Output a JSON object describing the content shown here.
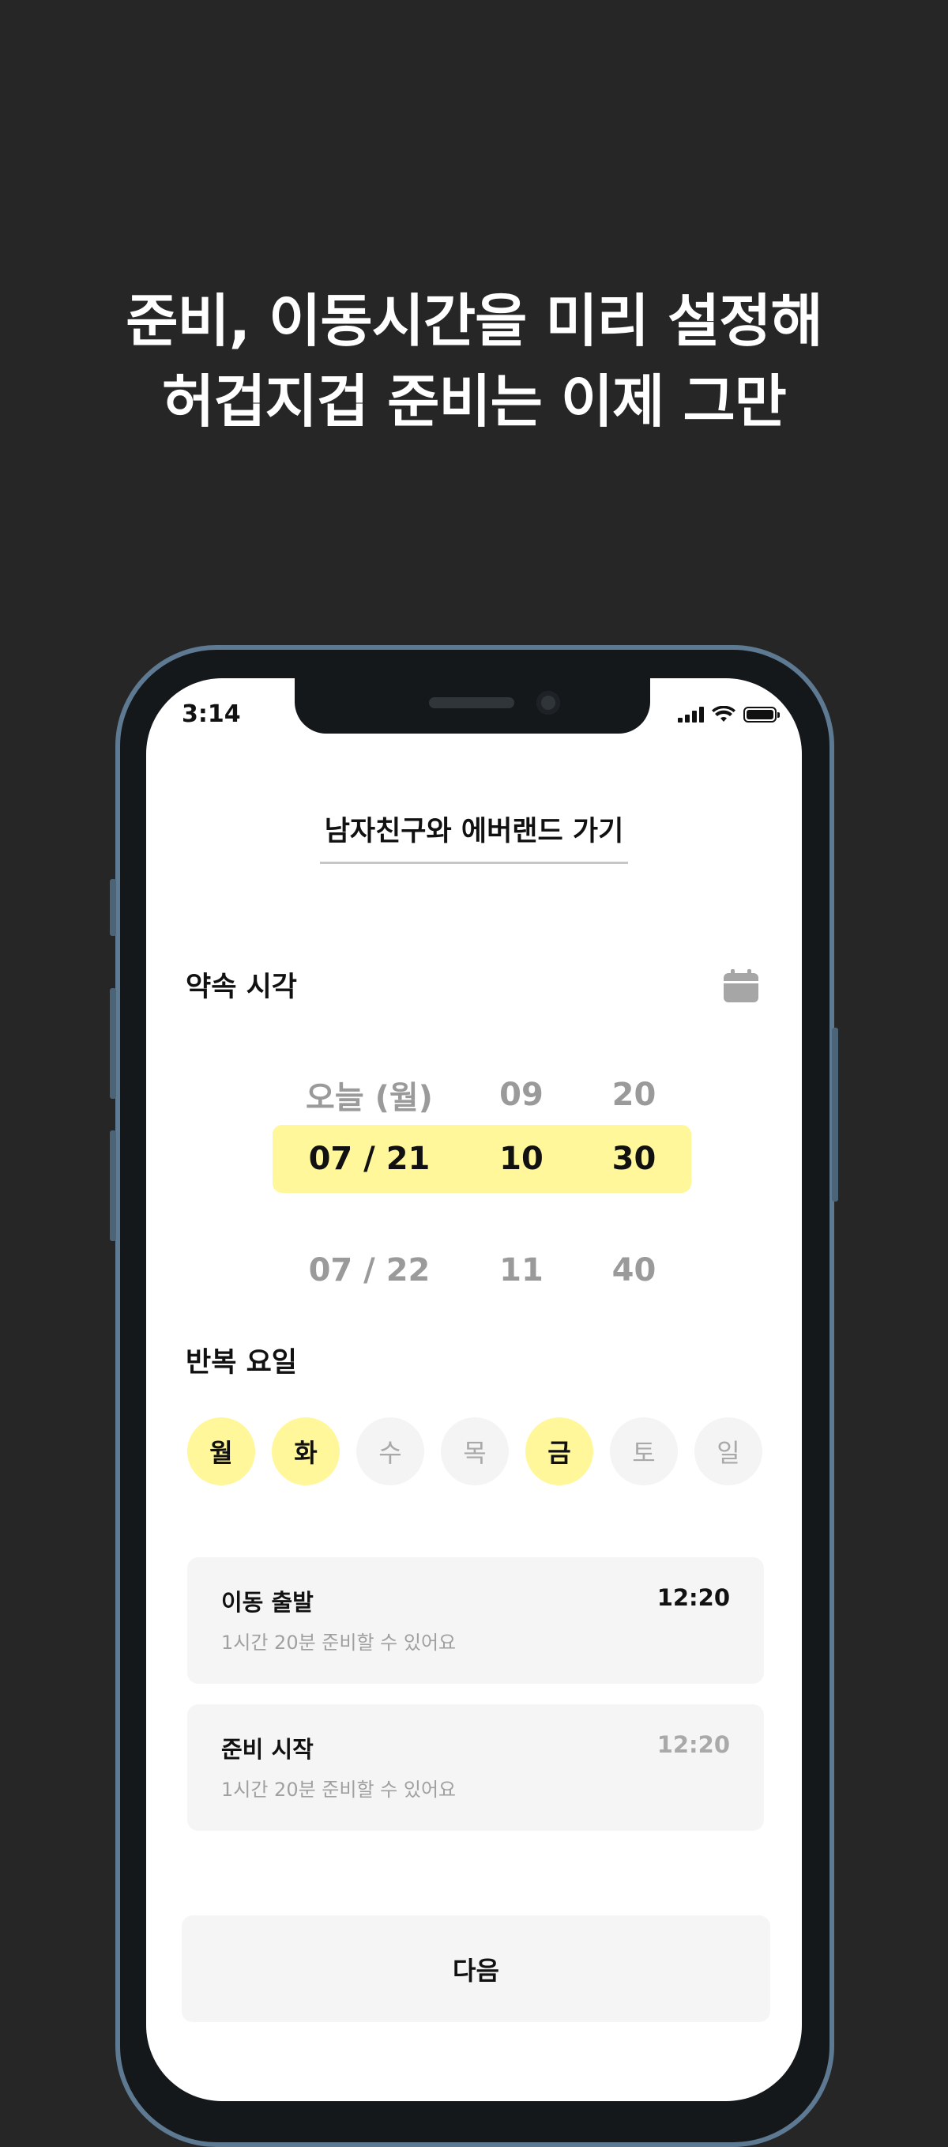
{
  "headline": {
    "line1": "준비, 이동시간을 미리 설정해",
    "line2": "허겁지겁 준비는 이제 그만"
  },
  "status_bar": {
    "time": "3:14",
    "icons": [
      "cellular-signal-icon",
      "wifi-icon",
      "battery-icon"
    ]
  },
  "event": {
    "title": "남자친구와 에버랜드 가기"
  },
  "appointment": {
    "label": "약속 시각",
    "calendar_icon": "calendar-icon",
    "picker": {
      "previous": {
        "date": "오늘 (월)",
        "hour": "09",
        "minute": "20"
      },
      "selected": {
        "date": "07 / 21",
        "hour": "10",
        "minute": "30"
      },
      "next": {
        "date": "07 / 22",
        "hour": "11",
        "minute": "40"
      }
    }
  },
  "repeat": {
    "label": "반복 요일",
    "days": [
      {
        "label": "월",
        "selected": true
      },
      {
        "label": "화",
        "selected": true
      },
      {
        "label": "수",
        "selected": false
      },
      {
        "label": "목",
        "selected": false
      },
      {
        "label": "금",
        "selected": true
      },
      {
        "label": "토",
        "selected": false
      },
      {
        "label": "일",
        "selected": false
      }
    ]
  },
  "schedule": [
    {
      "title": "이동 출발",
      "subtitle": "1시간 20분 준비할 수 있어요",
      "time": "12:20"
    },
    {
      "title": "준비 시작",
      "subtitle": "1시간 20분 준비할 수 있어요",
      "time": "12:20"
    }
  ],
  "next_button": "다음",
  "colors": {
    "background": "#262626",
    "accent": "#fff79a",
    "card": "#f5f5f5",
    "muted_text": "#9a9a9a",
    "phone_frame": "#5d7a92"
  }
}
